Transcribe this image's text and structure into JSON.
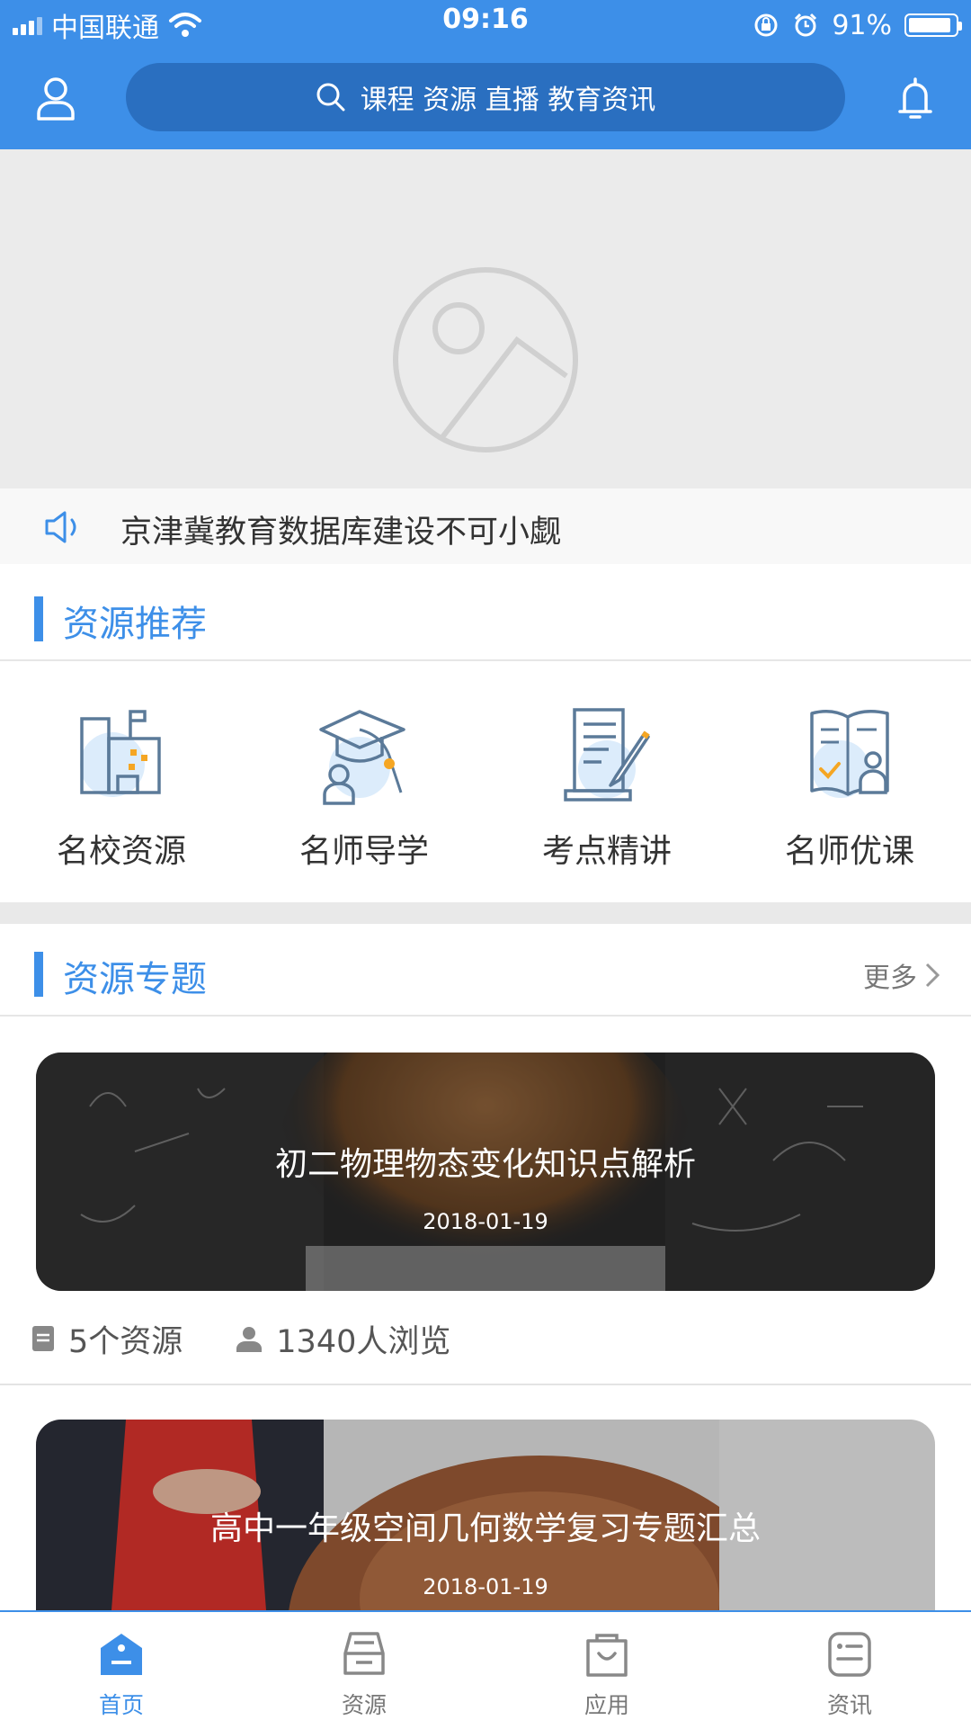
{
  "status_bar": {
    "carrier": "中国联通",
    "time": "09:16",
    "battery": "91%"
  },
  "header": {
    "search_placeholder": "课程 资源 直播 教育资讯"
  },
  "notice": {
    "text": "京津冀教育数据库建设不可小觑"
  },
  "recommend": {
    "title": "资源推荐",
    "items": [
      {
        "label": "名校资源",
        "icon": "school-icon"
      },
      {
        "label": "名师导学",
        "icon": "graduation-cap-icon"
      },
      {
        "label": "考点精讲",
        "icon": "document-pen-icon"
      },
      {
        "label": "名师优课",
        "icon": "book-teacher-icon"
      }
    ]
  },
  "topics": {
    "title": "资源专题",
    "more": "更多",
    "cards": [
      {
        "title": "初二物理物态变化知识点解析",
        "date": "2018-01-19",
        "resources": "5个资源",
        "views": "1340人浏览"
      },
      {
        "title": "高中一年级空间几何数学复习专题汇总",
        "date": "2018-01-19"
      }
    ]
  },
  "tabs": [
    {
      "label": "首页",
      "icon": "home-icon",
      "active": true
    },
    {
      "label": "资源",
      "icon": "resource-icon",
      "active": false
    },
    {
      "label": "应用",
      "icon": "bag-icon",
      "active": false
    },
    {
      "label": "资讯",
      "icon": "news-icon",
      "active": false
    }
  ],
  "colors": {
    "primary": "#3d8fe8",
    "search_bg": "#2a6fc0",
    "accent_orange": "#f5a623"
  }
}
